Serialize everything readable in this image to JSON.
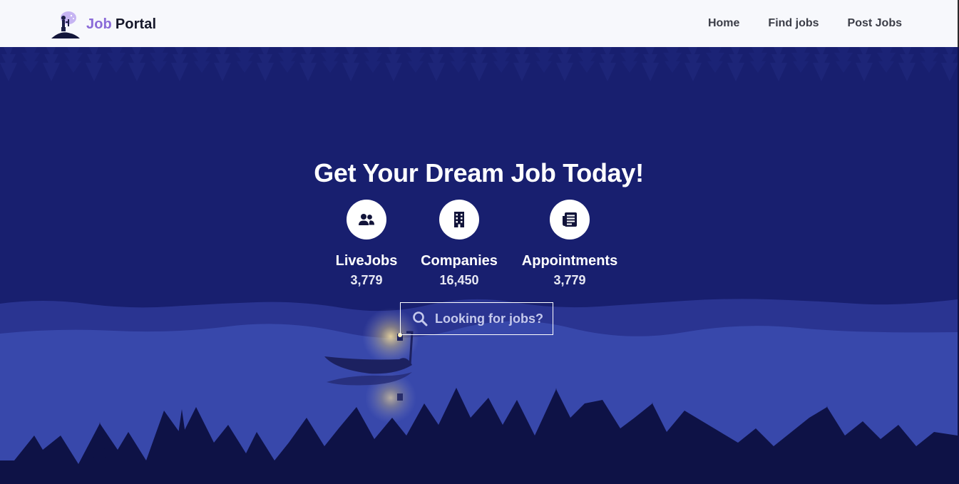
{
  "brand": {
    "part1": "Job",
    "part2": "Portal"
  },
  "nav": {
    "home": "Home",
    "find_jobs": "Find jobs",
    "post_jobs": "Post Jobs"
  },
  "hero": {
    "title": "Get Your Dream Job Today!",
    "stats": [
      {
        "label": "LiveJobs",
        "value": "3,779",
        "icon": "users-icon"
      },
      {
        "label": "Companies",
        "value": "16,450",
        "icon": "building-icon"
      },
      {
        "label": "Appointments",
        "value": "3,779",
        "icon": "newspaper-icon"
      }
    ],
    "search": {
      "placeholder": "Looking for jobs?",
      "icon": "search-icon"
    }
  },
  "colors": {
    "nav_bg": "#f7f8fc",
    "brand_accent": "#8a6ad8",
    "sky": "#181f6f",
    "lake": "#3848ab",
    "forest": "#0e1246",
    "lamp_glow": "#ffe38a"
  }
}
